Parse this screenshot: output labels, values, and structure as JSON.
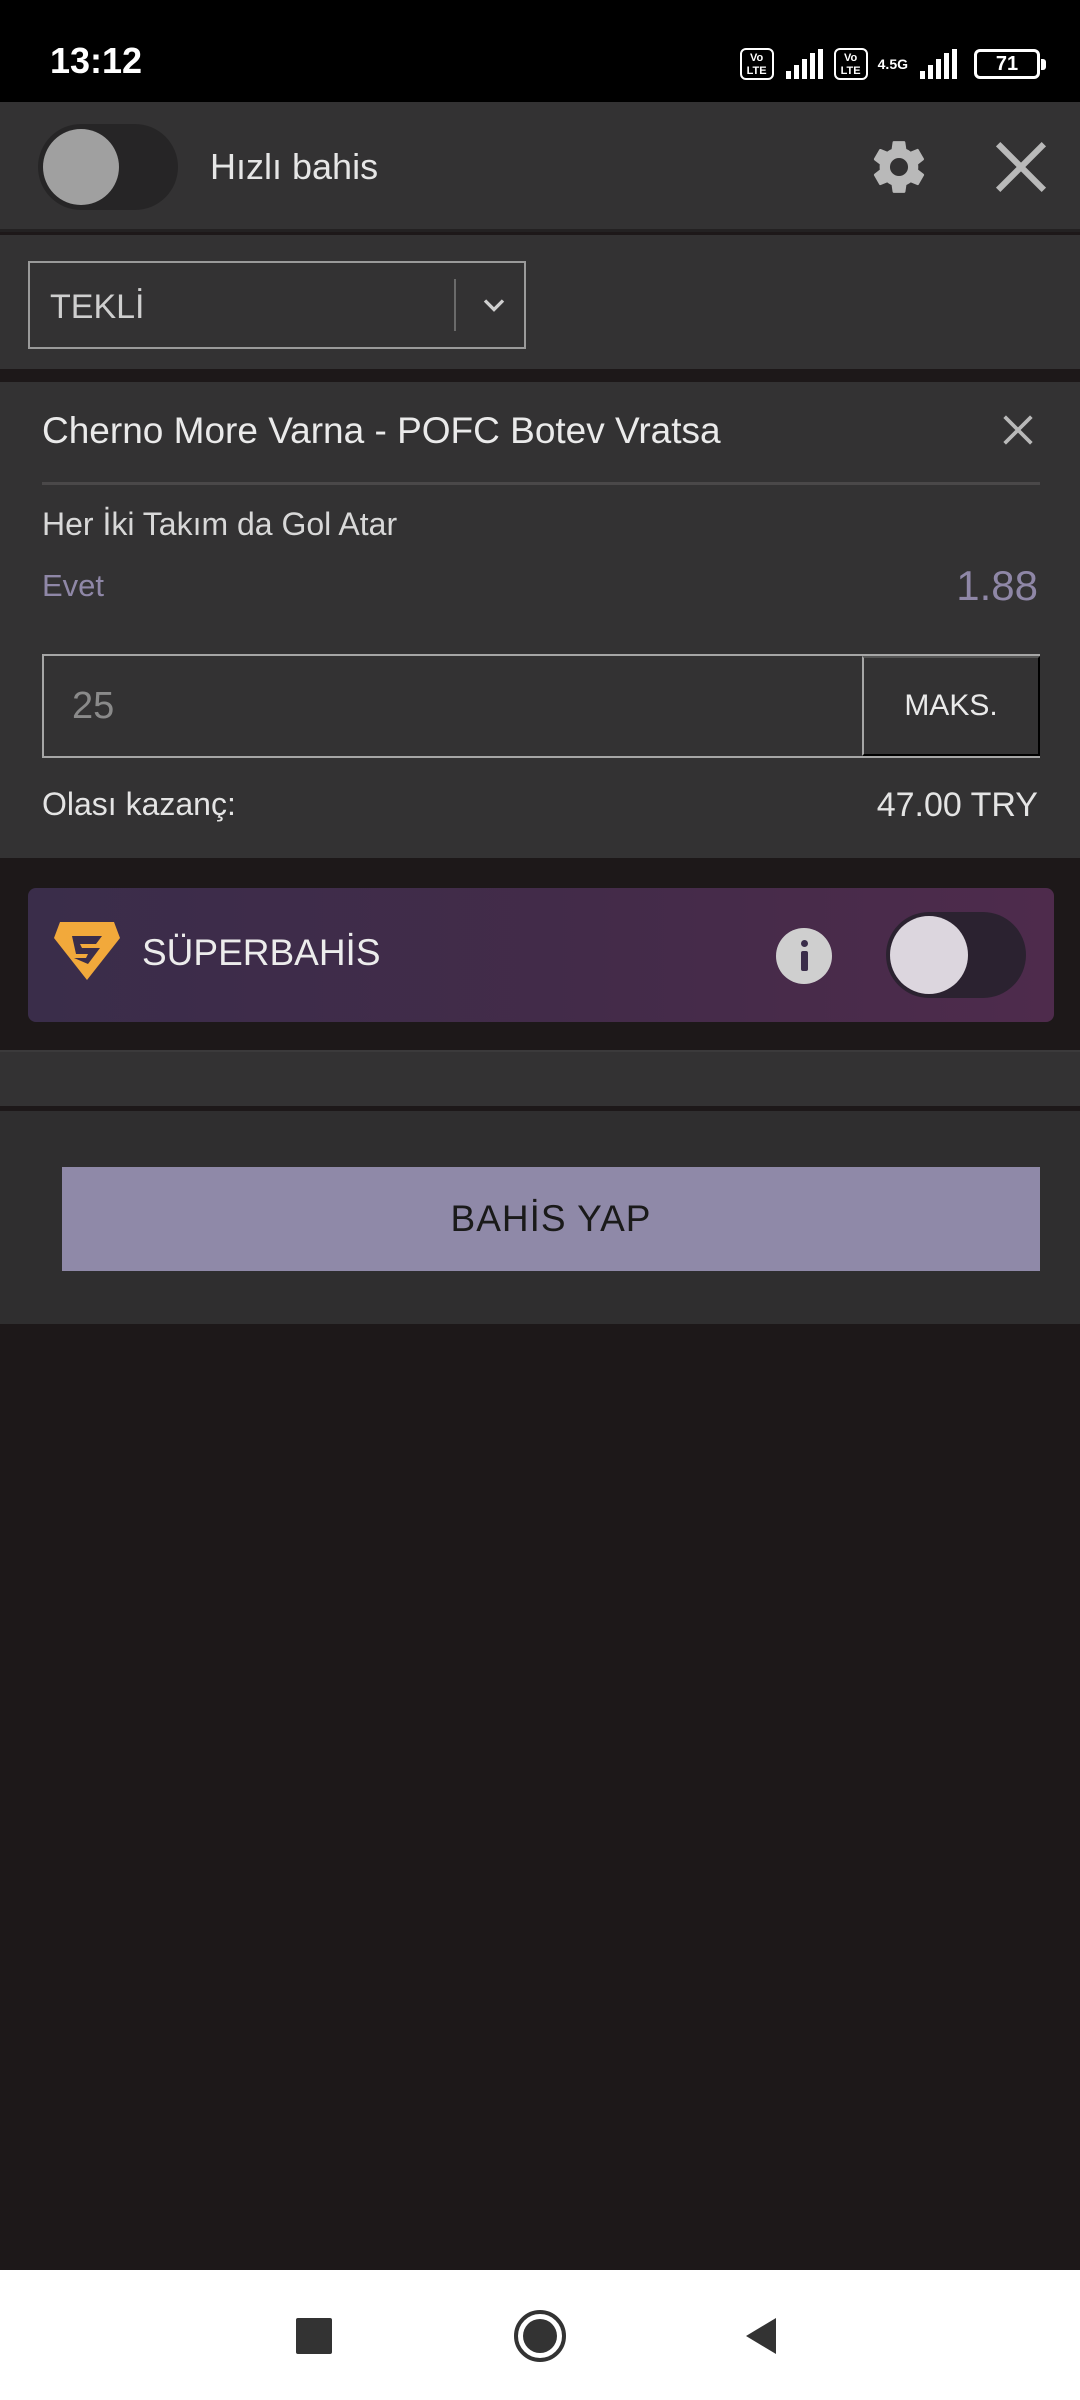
{
  "status_bar": {
    "time": "13:12",
    "sim1_label": "Vo LTE",
    "sim2_label": "Vo LTE",
    "network": "4.5G",
    "battery": "71"
  },
  "header": {
    "quick_bet_label": "Hızlı bahis",
    "quick_bet_enabled": false,
    "settings_icon": "gear-icon",
    "close_icon": "close-icon"
  },
  "bet_type": {
    "selected": "TEKLİ"
  },
  "bet": {
    "match": "Cherno More Varna - POFC Botev Vratsa",
    "market": "Her İki Takım da Gol Atar",
    "selection": "Evet",
    "odds": "1.88",
    "stake_placeholder": "25",
    "max_label": "MAKS.",
    "potential_win_label": "Olası kazanç:",
    "potential_win_value": "47.00 TRY"
  },
  "super_bet": {
    "label": "SÜPERBAHİS",
    "enabled": false
  },
  "submit": {
    "label": "BAHİS YAP"
  },
  "colors": {
    "accent": "#8f89a8",
    "panel": "#333233",
    "background": "#1d1819",
    "super_logo": "#f2a93b"
  }
}
